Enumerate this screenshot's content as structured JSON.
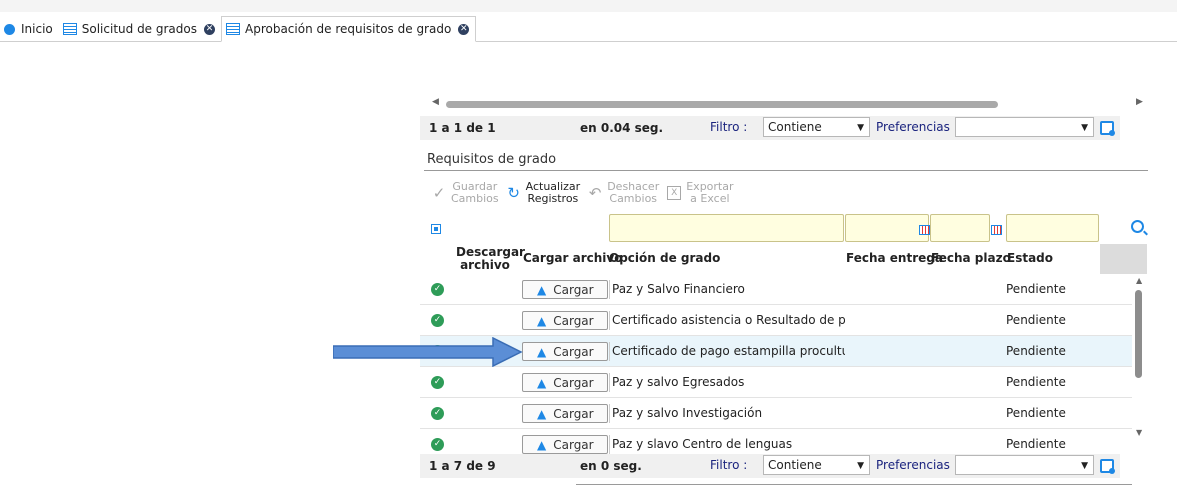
{
  "tabs": [
    {
      "label": "Inicio",
      "icon": "home-circle-icon",
      "active": false
    },
    {
      "label": "Solicitud de grados",
      "icon": "grid-icon",
      "active": false
    },
    {
      "label": "Aprobación de requisitos de grado",
      "icon": "grid-icon",
      "active": true
    }
  ],
  "pager_top": {
    "count": "1 a 1 de 1",
    "time": "en 0.04 seg.",
    "filter_label": "Filtro :",
    "filter_value": "Contiene",
    "prefs_label": "Preferencias :",
    "prefs_value": ""
  },
  "section_title": "Requisitos de grado",
  "toolbar": {
    "save": {
      "line1": "Guardar",
      "line2": "Cambios",
      "enabled": false
    },
    "refresh": {
      "line1": "Actualizar",
      "line2": "Registros",
      "enabled": true
    },
    "undo": {
      "line1": "Deshacer",
      "line2": "Cambios",
      "enabled": false
    },
    "export": {
      "line1": "Exportar",
      "line2": "a Excel",
      "enabled": false
    }
  },
  "columns": {
    "download_line1": "Descargar",
    "download_line2": "archivo",
    "upload": "Cargar archivo",
    "option": "Opción de grado",
    "delivery_date": "Fecha entrega",
    "deadline": "Fecha plazo",
    "status": "Estado"
  },
  "upload_button_label": "Cargar",
  "rows": [
    {
      "option": "Paz y Salvo Financiero",
      "status": "Pendiente",
      "highlighted": false
    },
    {
      "option": "Certificado asistencia o Resultado de prueb",
      "status": "Pendiente",
      "highlighted": false
    },
    {
      "option": "Certificado de pago estampilla procultura",
      "status": "Pendiente",
      "highlighted": true
    },
    {
      "option": "Paz y salvo Egresados",
      "status": "Pendiente",
      "highlighted": false
    },
    {
      "option": "Paz y salvo Investigación",
      "status": "Pendiente",
      "highlighted": false
    },
    {
      "option": "Paz y slavo Centro de lenguas",
      "status": "Pendiente",
      "highlighted": false
    }
  ],
  "pager_bottom": {
    "count": "1 a 7 de 9",
    "time": "en 0 seg.",
    "filter_label": "Filtro :",
    "filter_value": "Contiene",
    "prefs_label": "Preferencias :",
    "prefs_value": ""
  },
  "colors": {
    "accent": "#1e88e5",
    "success": "#2e9c58",
    "filter_bg": "#fffee0",
    "highlight_row": "#e9f5fb",
    "annotation_arrow": "#5b8ed6"
  }
}
